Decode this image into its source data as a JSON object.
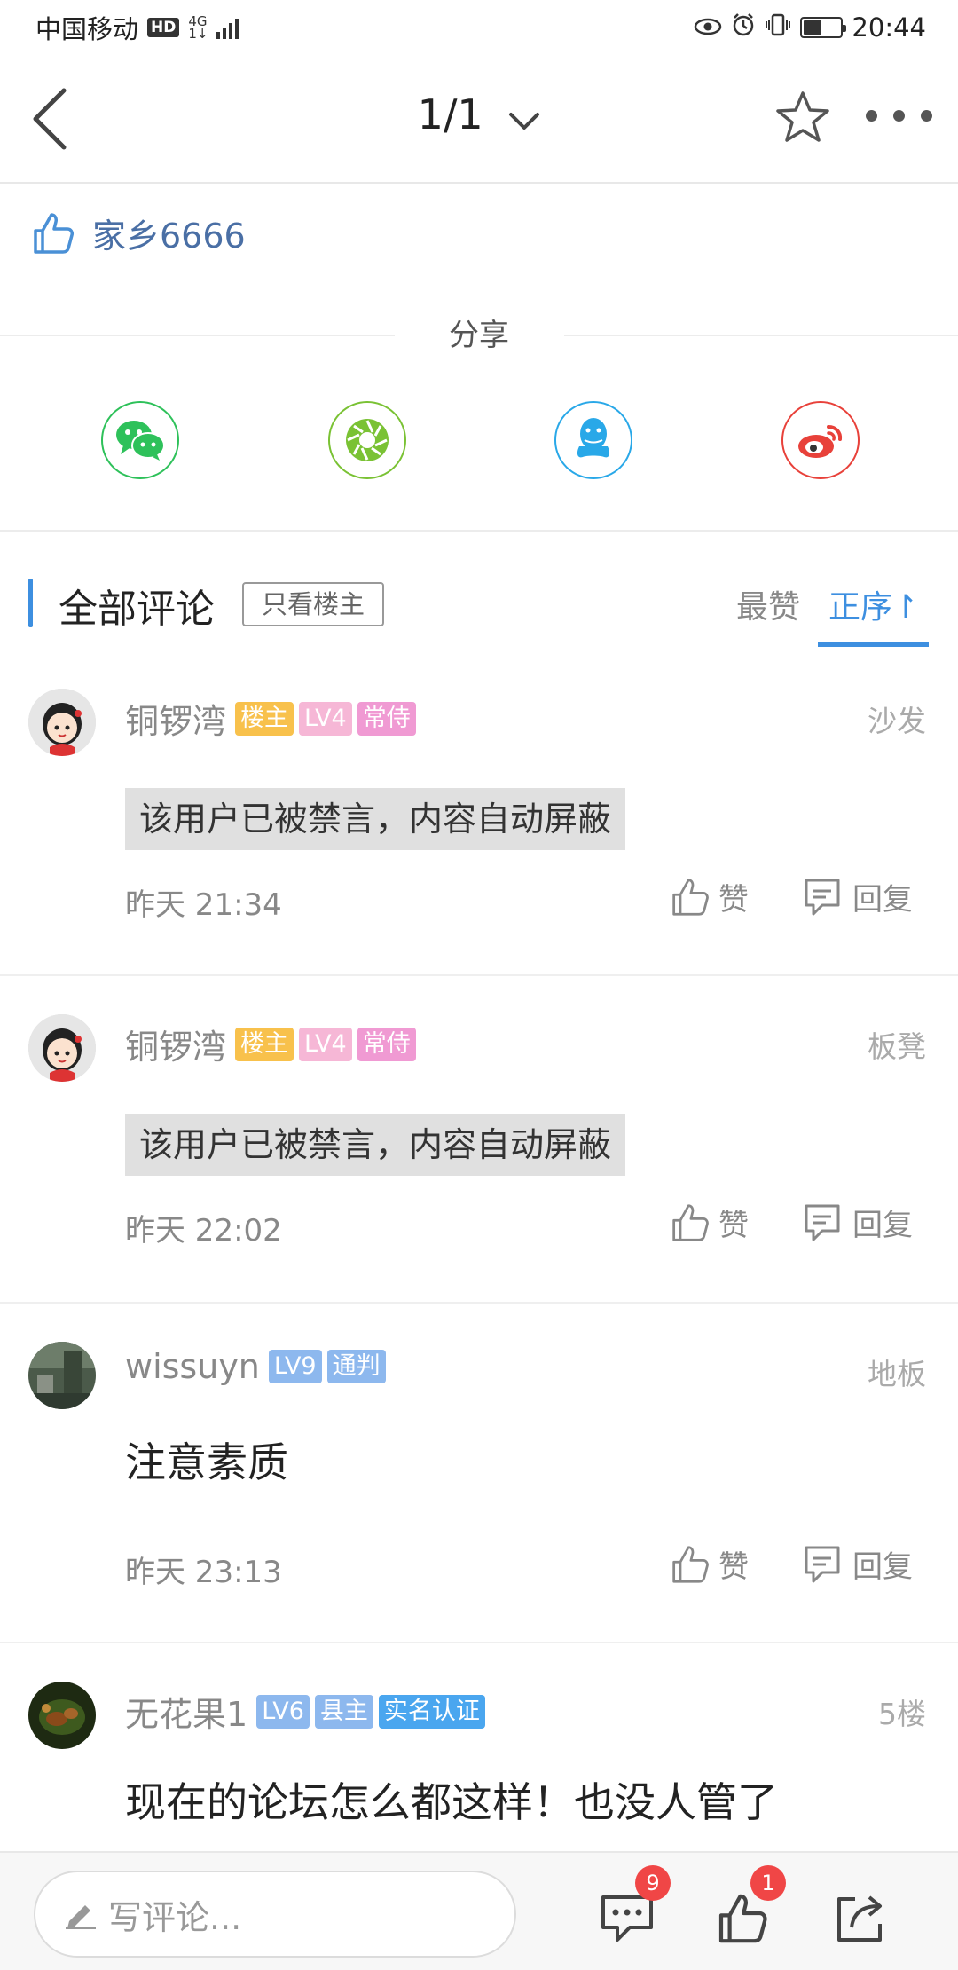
{
  "status_bar": {
    "carrier": "中国移动",
    "hd": "HD",
    "network_top": "4G",
    "network_bottom": "1↓",
    "time": "20:44",
    "battery_level": 0.5
  },
  "nav": {
    "pager": "1/1"
  },
  "like_bar": {
    "user": "家乡6666"
  },
  "share": {
    "label": "分享",
    "targets": [
      {
        "name": "wechat",
        "color": "#2ec15a"
      },
      {
        "name": "moments",
        "color": "#7ac234"
      },
      {
        "name": "qq",
        "color": "#29a8e8"
      },
      {
        "name": "weibo",
        "color": "#e8413a"
      }
    ]
  },
  "comments_header": {
    "title": "全部评论",
    "only_op": "只看楼主",
    "sort_hot": "最赞",
    "sort_order": "正序↾"
  },
  "comments": [
    {
      "name": "铜锣湾",
      "tags": [
        {
          "text": "楼主",
          "color": "#f8c14c"
        },
        {
          "text": "LV4",
          "color": "#f6b7d6"
        },
        {
          "text": "常侍",
          "color": "#f09ad3"
        }
      ],
      "floor": "沙发",
      "content": "该用户已被禁言，内容自动屏蔽",
      "banned": true,
      "time": "昨天 21:34",
      "like_label": "赞",
      "reply_label": "回复"
    },
    {
      "name": "铜锣湾",
      "tags": [
        {
          "text": "楼主",
          "color": "#f8c14c"
        },
        {
          "text": "LV4",
          "color": "#f6b7d6"
        },
        {
          "text": "常侍",
          "color": "#f09ad3"
        }
      ],
      "floor": "板凳",
      "content": "该用户已被禁言，内容自动屏蔽",
      "banned": true,
      "time": "昨天 22:02",
      "like_label": "赞",
      "reply_label": "回复"
    },
    {
      "name": "wissuyn",
      "tags": [
        {
          "text": "LV9",
          "color": "#8db8ee"
        },
        {
          "text": "通判",
          "color": "#8db8ee"
        }
      ],
      "floor": "地板",
      "content": "注意素质",
      "banned": false,
      "time": "昨天 23:13",
      "like_label": "赞",
      "reply_label": "回复"
    },
    {
      "name": "无花果1",
      "tags": [
        {
          "text": "LV6",
          "color": "#8db8ee"
        },
        {
          "text": "县主",
          "color": "#8db8ee"
        },
        {
          "text": "实名认证",
          "color": "#4aa6ef"
        }
      ],
      "floor": "5楼",
      "content": "现在的论坛怎么都这样！也没人管了",
      "banned": false
    }
  ],
  "bottom_bar": {
    "placeholder": "写评论...",
    "comment_count": "9",
    "like_count": "1"
  }
}
